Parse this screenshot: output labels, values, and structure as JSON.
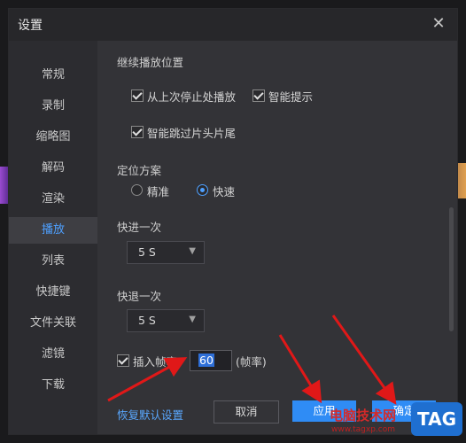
{
  "dialog": {
    "title": "设置",
    "close_icon": "close-icon"
  },
  "sidebar": {
    "items": [
      {
        "label": "常规"
      },
      {
        "label": "录制"
      },
      {
        "label": "缩略图"
      },
      {
        "label": "解码"
      },
      {
        "label": "渲染"
      },
      {
        "label": "播放",
        "active": true
      },
      {
        "label": "列表"
      },
      {
        "label": "快捷键"
      },
      {
        "label": "文件关联"
      },
      {
        "label": "滤镜"
      },
      {
        "label": "下载"
      }
    ]
  },
  "resume": {
    "title": "继续播放位置",
    "opt1": "从上次停止处播放",
    "opt2": "智能提示",
    "opt3": "智能跳过片头片尾"
  },
  "seek_mode": {
    "title": "定位方案",
    "opt_precise": "精准",
    "opt_fast": "快速",
    "selected": "快速"
  },
  "forward": {
    "title": "快进一次",
    "value": "5 S"
  },
  "backward": {
    "title": "快退一次",
    "value": "5 S"
  },
  "insert_frame": {
    "label": "插入帧率",
    "value": "60",
    "unit": "(帧率)"
  },
  "footer": {
    "restore_label": "恢复默认设置",
    "cancel_label": "取消",
    "apply_label": "应用",
    "ok_label": "确定"
  },
  "watermark": {
    "site_name": "电脑技术网",
    "url": "www.tagxp.com",
    "badge": "TAG"
  },
  "colors": {
    "accent": "#2f8cf5",
    "active_text": "#4ea0ff",
    "arrow": "#e01818"
  }
}
